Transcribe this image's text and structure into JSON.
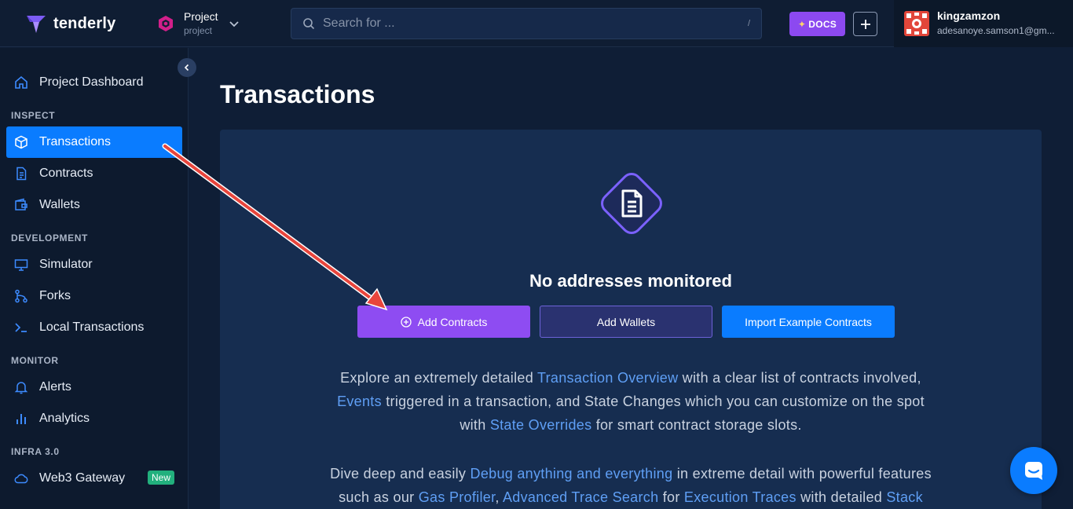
{
  "header": {
    "brand": "tenderly",
    "project_name": "Project",
    "project_slug": "project",
    "search_placeholder": "Search for ...",
    "search_shortcut": "/",
    "docs_label": "DOCS",
    "user_name": "kingzamzon",
    "user_email": "adesanoye.samson1@gm..."
  },
  "sidebar": {
    "dashboard": "Project Dashboard",
    "sections": {
      "inspect": "INSPECT",
      "development": "DEVELOPMENT",
      "monitor": "MONITOR",
      "infra": "INFRA 3.0"
    },
    "items": {
      "transactions": "Transactions",
      "contracts": "Contracts",
      "wallets": "Wallets",
      "simulator": "Simulator",
      "forks": "Forks",
      "local_transactions": "Local Transactions",
      "alerts": "Alerts",
      "analytics": "Analytics",
      "web3_gateway": "Web3 Gateway"
    },
    "new_badge": "New"
  },
  "main": {
    "title": "Transactions",
    "empty_title": "No addresses monitored",
    "buttons": {
      "add_contracts": "Add Contracts",
      "add_wallets": "Add Wallets",
      "import_examples": "Import Example Contracts"
    },
    "para1": {
      "t1": "Explore an extremely detailed ",
      "l1": "Transaction Overview",
      "t2": " with a clear list of contracts involved,",
      "l2": "Events",
      "t3": " triggered in a transaction, and State Changes which you can customize on the spot",
      "t4": "with ",
      "l3": "State Overrides",
      "t5": " for smart contract storage slots."
    },
    "para2": {
      "t1": "Dive deep and easily ",
      "l1": "Debug anything and everything",
      "t2": " in extreme detail with powerful features",
      "t3": "such as our ",
      "l2": "Gas Profiler",
      "t4": ", ",
      "l3": "Advanced Trace Search",
      "t5": " for ",
      "l4": "Execution Traces",
      "t6": " with detailed ",
      "l5": "Stack"
    }
  },
  "colors": {
    "accent_blue": "#0a7cff",
    "accent_purple": "#8e4cf2",
    "annotation_arrow": "#e8453c"
  }
}
